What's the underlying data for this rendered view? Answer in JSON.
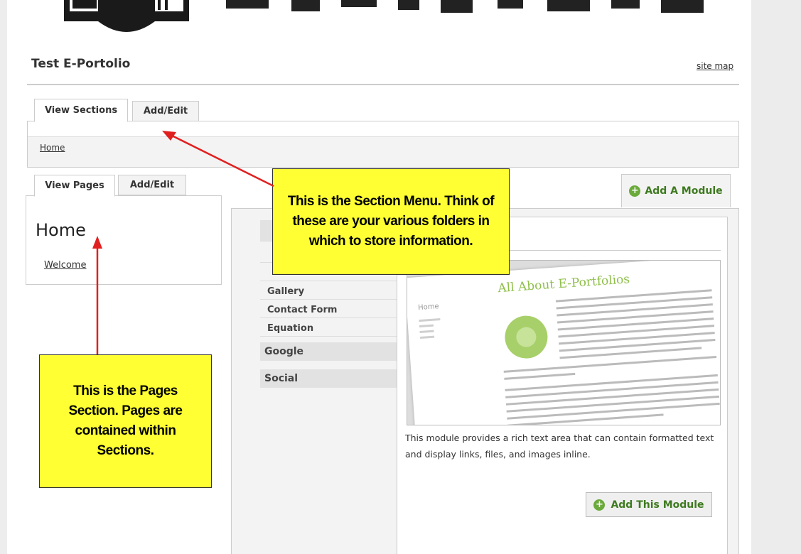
{
  "site": {
    "title": "Test E-Portolio",
    "sitemap_label": "site map"
  },
  "section_tabs": [
    {
      "label": "View Sections"
    },
    {
      "label": "Add/Edit"
    }
  ],
  "breadcrumb": {
    "home": "Home"
  },
  "page_tabs": [
    {
      "label": "View Pages"
    },
    {
      "label": "Add/Edit"
    }
  ],
  "pages": {
    "title": "Home",
    "items": [
      "Welcome"
    ]
  },
  "modules": {
    "add_module_label": "Add A Module",
    "list_items": [
      "Gallery",
      "Contact Form",
      "Equation"
    ],
    "categories": [
      "Google",
      "Social"
    ],
    "preview": {
      "heading": "All About E-Portfolios",
      "sidebar_title": "Home"
    },
    "description": "This module provides a rich text area that can contain formatted text and display links, files, and images inline.",
    "add_this_label": "Add This Module"
  },
  "callouts": [
    {
      "text": "This is the Section Menu. Think of these are your various folders in which to store information."
    },
    {
      "text": "This is the Pages Section. Pages are contained within Sections."
    }
  ],
  "colors": {
    "callout_bg": "#ffff33",
    "arrow": "#e02020",
    "accent_green": "#3e7a1f",
    "preview_heading": "#8fbf4a"
  }
}
